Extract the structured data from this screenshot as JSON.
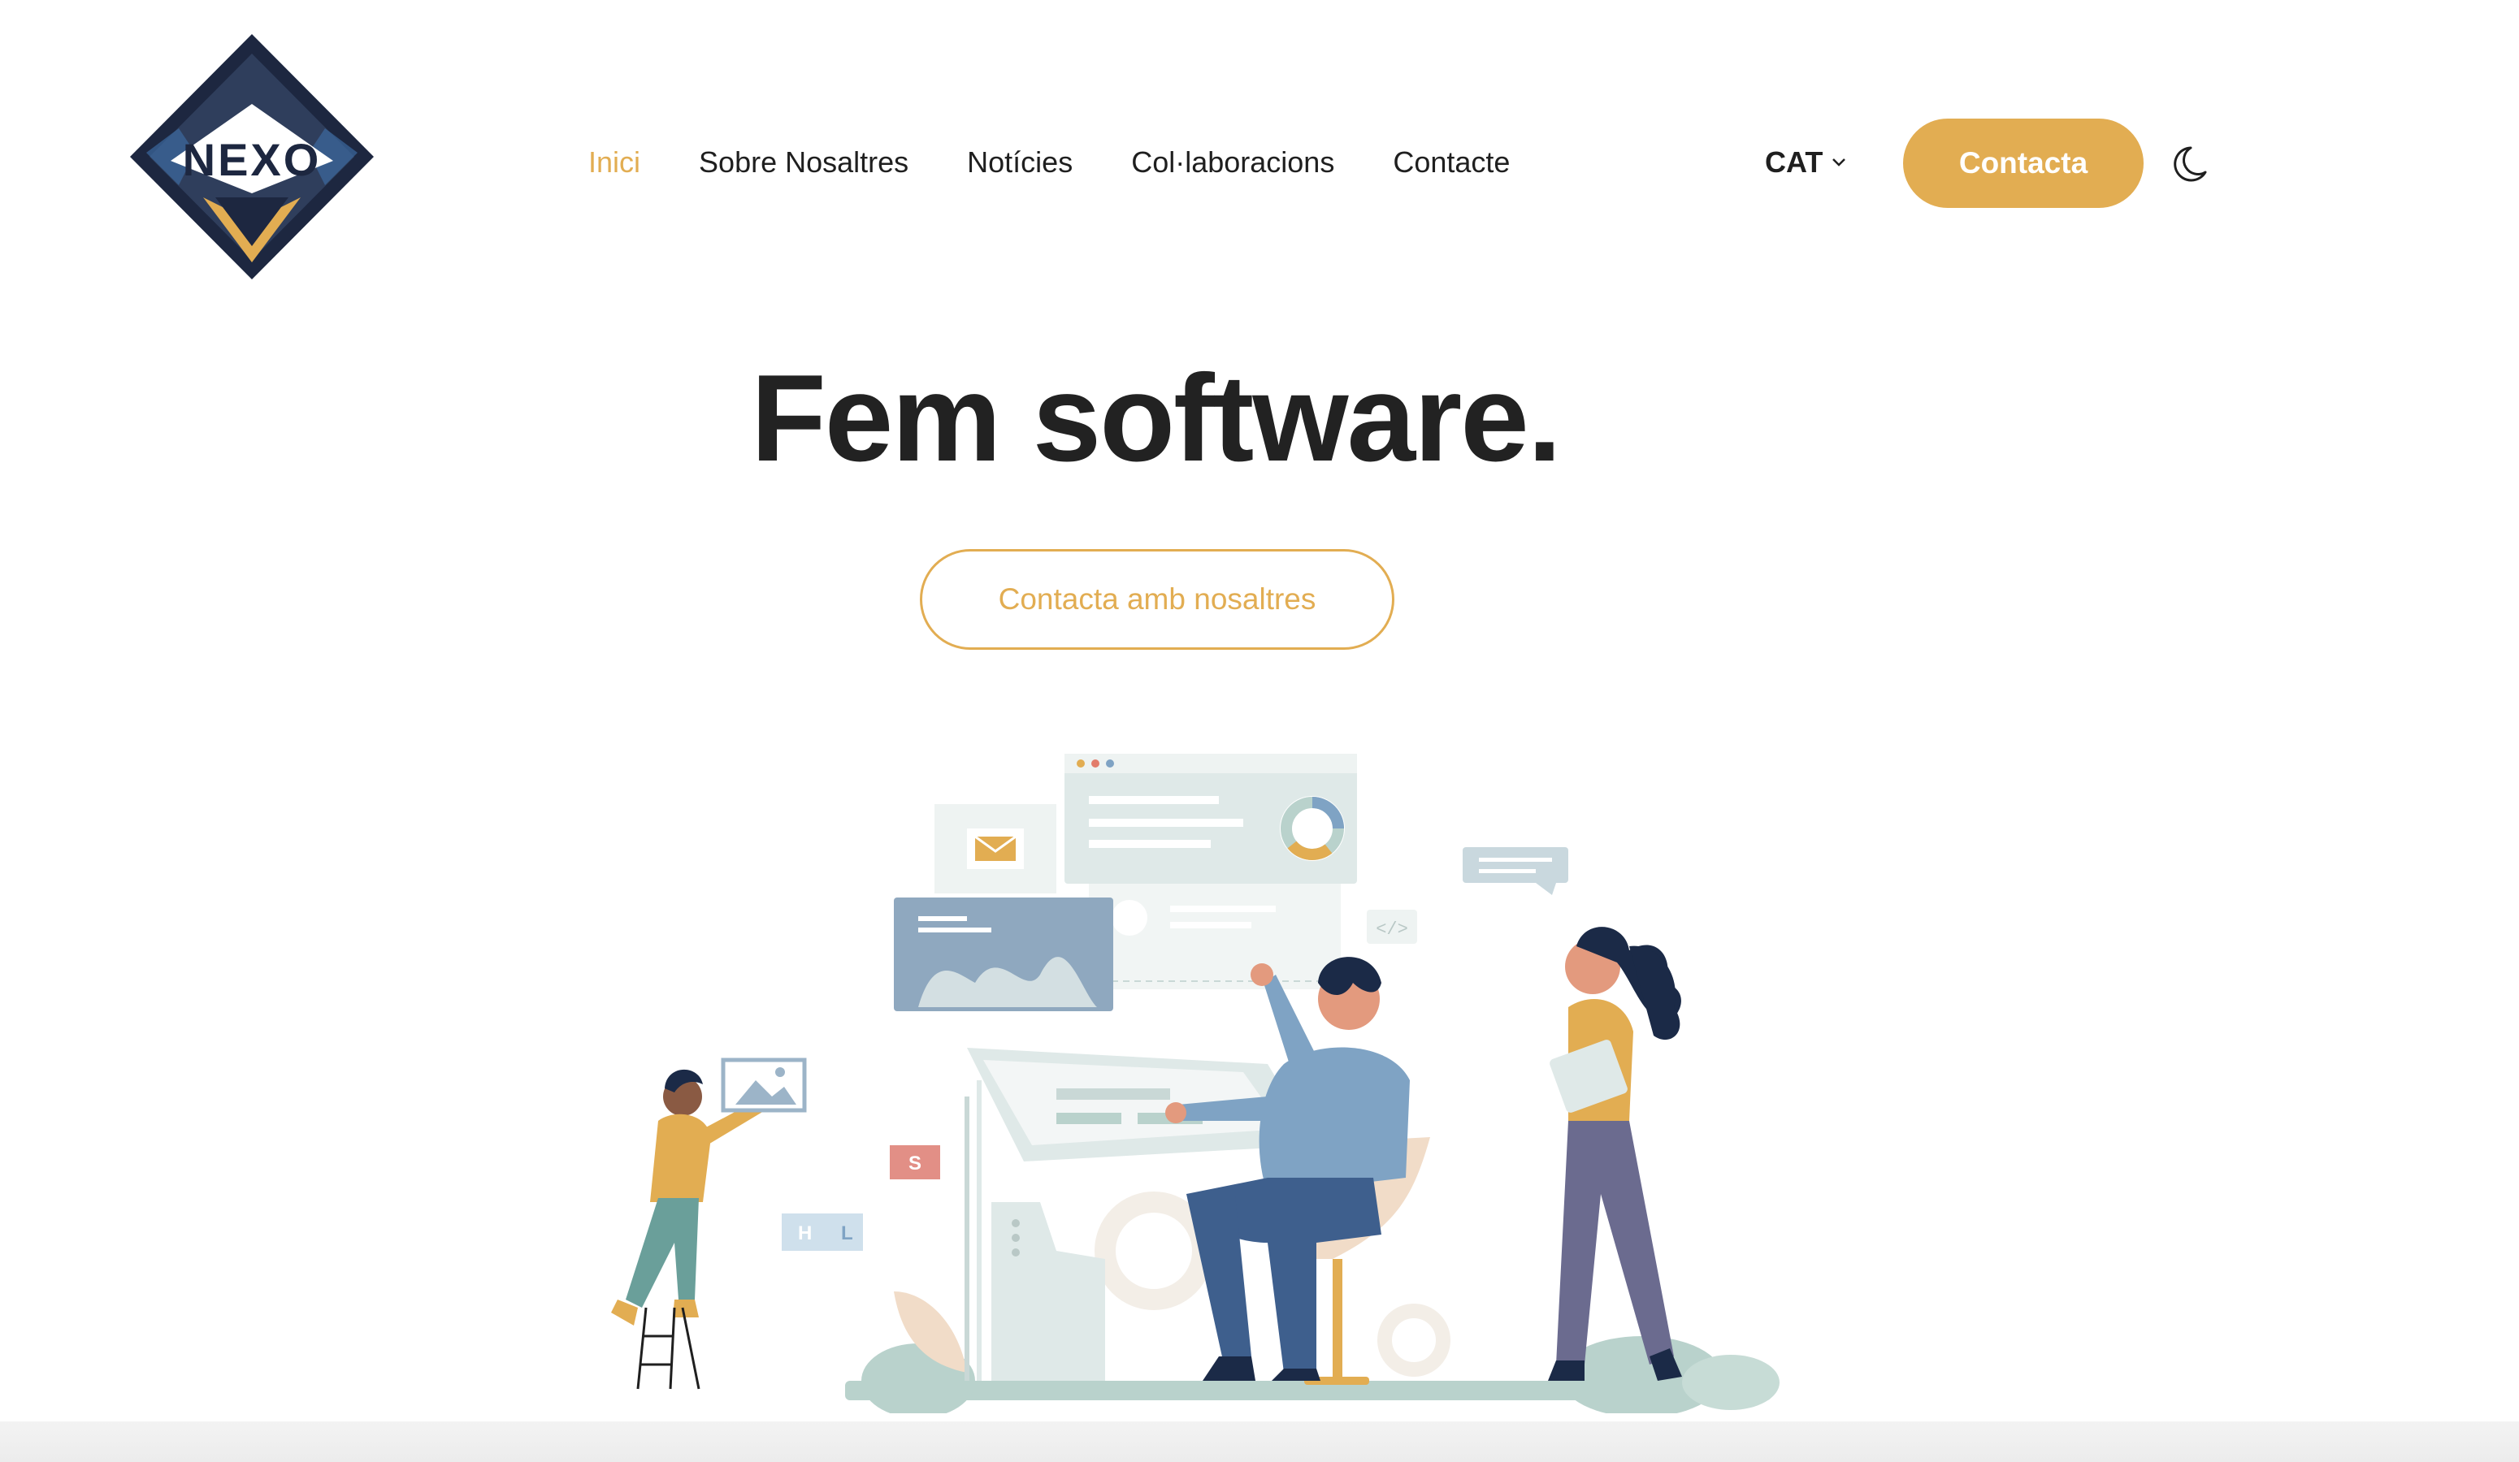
{
  "brand": {
    "name": "NEXO"
  },
  "nav": {
    "items": [
      {
        "label": "Inici",
        "active": true
      },
      {
        "label": "Sobre Nosaltres",
        "active": false
      },
      {
        "label": "Notícies",
        "active": false
      },
      {
        "label": "Col·laboracions",
        "active": false
      },
      {
        "label": "Contacte",
        "active": false
      }
    ]
  },
  "header": {
    "language": "CAT",
    "cta_label": "Contacta",
    "theme_icon": "moon-icon"
  },
  "hero": {
    "title": "Fem software.",
    "button_label": "Contacta amb nosaltres"
  },
  "illustration": {
    "code_tag": "</>",
    "letter_s": "S",
    "letter_h": "H",
    "letter_l": "L"
  },
  "colors": {
    "accent": "#e2ad52",
    "text": "#222222",
    "navy": "#1b2a47",
    "slate_blue": "#7fa3c4",
    "sage": "#b9d2cc"
  }
}
